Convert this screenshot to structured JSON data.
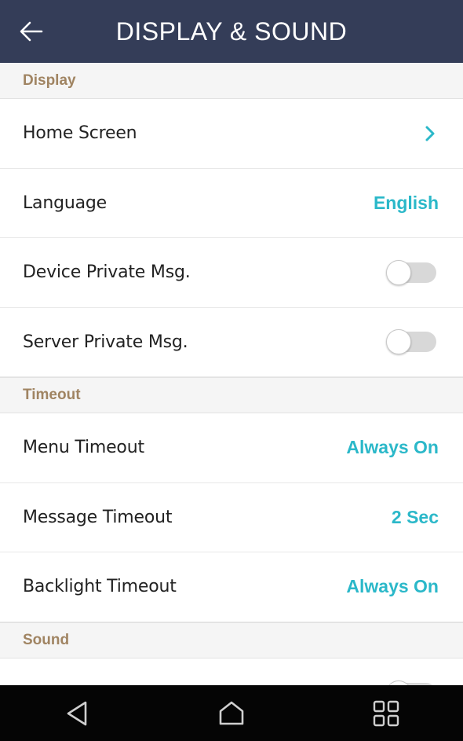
{
  "app_bar": {
    "title": "DISPLAY & SOUND",
    "back_icon": "arrow-left-icon"
  },
  "sections": [
    {
      "header": "Display",
      "rows": [
        {
          "label": "Home Screen",
          "control": "chevron"
        },
        {
          "label": "Language",
          "control": "value",
          "value": "English"
        },
        {
          "label": "Device Private Msg.",
          "control": "toggle",
          "on": false
        },
        {
          "label": "Server Private Msg.",
          "control": "toggle",
          "on": false
        }
      ]
    },
    {
      "header": "Timeout",
      "rows": [
        {
          "label": "Menu Timeout",
          "control": "value",
          "value": "Always On"
        },
        {
          "label": "Message Timeout",
          "control": "value",
          "value": "2 Sec"
        },
        {
          "label": "Backlight Timeout",
          "control": "value",
          "value": "Always On"
        }
      ]
    },
    {
      "header": "Sound",
      "rows": [
        {
          "label": "",
          "control": "toggle",
          "on": false
        }
      ]
    }
  ],
  "nav_bar": {
    "back_icon": "triangle-back-icon",
    "home_icon": "home-icon",
    "recents_icon": "grid-recents-icon"
  },
  "colors": {
    "app_bar": "#343d58",
    "section_header_text": "#a08462",
    "accent": "#2bb8c9",
    "nav_bar": "#050505"
  }
}
